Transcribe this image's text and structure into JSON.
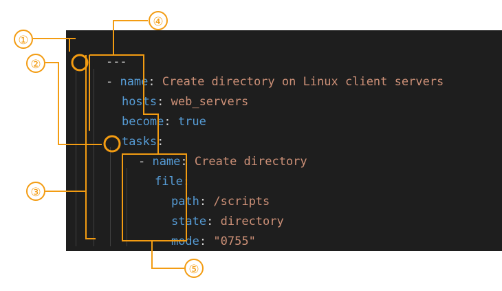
{
  "code": {
    "doc_start": "---",
    "line2": {
      "dash": "-",
      "key": "name",
      "colon": ":",
      "value": " Create directory on Linux client servers"
    },
    "line3": {
      "key": "hosts",
      "colon": ":",
      "value": " web_servers"
    },
    "line4": {
      "key": "become",
      "colon": ":",
      "value": " true"
    },
    "line5": {
      "key": "tasks",
      "colon": ":"
    },
    "line6": {
      "dash": "-",
      "key": "name",
      "colon": ":",
      "value": " Create directory"
    },
    "line7": {
      "key": "file",
      "colon": ":"
    },
    "line8": {
      "key": "path",
      "colon": ":",
      "value": " /scripts"
    },
    "line9": {
      "key": "state",
      "colon": ":",
      "value": " directory"
    },
    "line10": {
      "key": "mode",
      "colon": ":",
      "value": " \"0755\""
    }
  },
  "callouts": {
    "c1": "①",
    "c2": "②",
    "c3": "③",
    "c4": "④",
    "c5": "⑤"
  },
  "colors": {
    "editor_bg": "#1e1e1e",
    "keyword": "#569cd6",
    "string": "#ce9178",
    "punct": "#d4d4d4",
    "annotation": "#f39c12"
  }
}
